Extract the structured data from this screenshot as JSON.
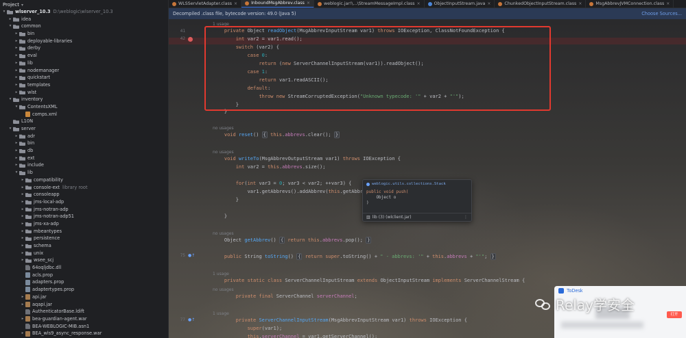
{
  "project": {
    "title": "Project",
    "root_name": "wlserver_10.3",
    "root_path": "D:\\weblogic\\wlserver_10.3",
    "items": [
      {
        "label": "idea",
        "depth": 1,
        "kind": "folder",
        "arrow": "right"
      },
      {
        "label": "common",
        "depth": 1,
        "kind": "folder",
        "arrow": "down"
      },
      {
        "label": "bin",
        "depth": 2,
        "kind": "folder",
        "arrow": "right"
      },
      {
        "label": "deployable-libraries",
        "depth": 2,
        "kind": "folder",
        "arrow": "right"
      },
      {
        "label": "derby",
        "depth": 2,
        "kind": "folder",
        "arrow": "right"
      },
      {
        "label": "eval",
        "depth": 2,
        "kind": "folder",
        "arrow": "right"
      },
      {
        "label": "lib",
        "depth": 2,
        "kind": "folder",
        "arrow": "right"
      },
      {
        "label": "nodemanager",
        "depth": 2,
        "kind": "folder",
        "arrow": "right"
      },
      {
        "label": "quickstart",
        "depth": 2,
        "kind": "folder",
        "arrow": "right"
      },
      {
        "label": "templates",
        "depth": 2,
        "kind": "folder",
        "arrow": "right"
      },
      {
        "label": "wlst",
        "depth": 2,
        "kind": "folder",
        "arrow": "right"
      },
      {
        "label": "inventory",
        "depth": 1,
        "kind": "folder",
        "arrow": "down"
      },
      {
        "label": "ContentsXML",
        "depth": 2,
        "kind": "folder",
        "arrow": "down"
      },
      {
        "label": "comps.xml",
        "depth": 3,
        "kind": "xml",
        "arrow": ""
      },
      {
        "label": "L10N",
        "depth": 1,
        "kind": "folder",
        "arrow": ""
      },
      {
        "label": "server",
        "depth": 1,
        "kind": "folder",
        "arrow": "down"
      },
      {
        "label": "adr",
        "depth": 2,
        "kind": "folder",
        "arrow": "right"
      },
      {
        "label": "bin",
        "depth": 2,
        "kind": "folder",
        "arrow": "right"
      },
      {
        "label": "db",
        "depth": 2,
        "kind": "folder",
        "arrow": "right"
      },
      {
        "label": "ext",
        "depth": 2,
        "kind": "folder",
        "arrow": "right"
      },
      {
        "label": "include",
        "depth": 2,
        "kind": "folder",
        "arrow": "right"
      },
      {
        "label": "lib",
        "depth": 2,
        "kind": "folder",
        "arrow": "down"
      },
      {
        "label": "compatibility",
        "depth": 3,
        "kind": "folder",
        "arrow": "right"
      },
      {
        "label": "console-ext",
        "depth": 3,
        "kind": "folder",
        "arrow": "right",
        "hint": "library root"
      },
      {
        "label": "consoleapp",
        "depth": 3,
        "kind": "folder",
        "arrow": "right"
      },
      {
        "label": "jms-local-adp",
        "depth": 3,
        "kind": "folder",
        "arrow": "right"
      },
      {
        "label": "jms-notran-adp",
        "depth": 3,
        "kind": "folder",
        "arrow": "right"
      },
      {
        "label": "jms-notran-adp51",
        "depth": 3,
        "kind": "folder",
        "arrow": "right"
      },
      {
        "label": "jms-xa-adp",
        "depth": 3,
        "kind": "folder",
        "arrow": "right"
      },
      {
        "label": "mbeantypes",
        "depth": 3,
        "kind": "folder",
        "arrow": "right"
      },
      {
        "label": "persistence",
        "depth": 3,
        "kind": "folder",
        "arrow": "right"
      },
      {
        "label": "schema",
        "depth": 3,
        "kind": "folder",
        "arrow": "right"
      },
      {
        "label": "unix",
        "depth": 3,
        "kind": "folder",
        "arrow": "right"
      },
      {
        "label": "wsee_scj",
        "depth": 3,
        "kind": "folder",
        "arrow": "right"
      },
      {
        "label": "64oqljdbc.dll",
        "depth": 3,
        "kind": "file",
        "arrow": ""
      },
      {
        "label": "acls.prop",
        "depth": 3,
        "kind": "prop",
        "arrow": ""
      },
      {
        "label": "adapters.prop",
        "depth": 3,
        "kind": "prop",
        "arrow": ""
      },
      {
        "label": "adaptertypes.prop",
        "depth": 3,
        "kind": "prop",
        "arrow": ""
      },
      {
        "label": "api.jar",
        "depth": 3,
        "kind": "jar",
        "arrow": "right"
      },
      {
        "label": "aqapi.jar",
        "depth": 3,
        "kind": "jar",
        "arrow": "right"
      },
      {
        "label": "AuthenticatorBase.ldift",
        "depth": 3,
        "kind": "file",
        "arrow": ""
      },
      {
        "label": "bea-guardian-agent.war",
        "depth": 3,
        "kind": "jar",
        "arrow": "right"
      },
      {
        "label": "BEA-WEBLOGIC-MIB.asn1",
        "depth": 3,
        "kind": "file",
        "arrow": ""
      },
      {
        "label": "BEA_wls9_async_response.war",
        "depth": 3,
        "kind": "jar",
        "arrow": "right"
      }
    ]
  },
  "tabs": [
    {
      "label": "WLSServletAdapter.class",
      "icon": "class",
      "active": false
    },
    {
      "label": "InboundMsgAbbrev.class",
      "icon": "class",
      "active": true
    },
    {
      "label": "weblogic.jar!\\...\\StreamMessageImpl.class",
      "icon": "class",
      "active": false
    },
    {
      "label": "ObjectInputStream.java",
      "icon": "java",
      "active": false
    },
    {
      "label": "ChunkedObjectInputStream.class",
      "icon": "class",
      "active": false
    },
    {
      "label": "MsgAbbrevJVMConnection.class",
      "icon": "class",
      "active": false
    }
  ],
  "banner": {
    "text": "Decompiled .class file, bytecode version: 49.0 (Java 5)",
    "action": "Choose Sources..."
  },
  "editor": {
    "line_numbers": [
      "41",
      "42",
      "",
      "",
      "",
      "",
      "",
      "",
      "",
      "",
      "",
      "",
      "",
      "",
      "",
      "",
      "",
      "",
      "",
      "",
      "",
      "",
      "",
      "",
      "",
      "",
      "",
      "",
      "",
      "",
      "",
      "",
      "",
      "",
      "",
      "",
      "75",
      "",
      "",
      "",
      "",
      "",
      "",
      "",
      "",
      "",
      "77"
    ],
    "usages_hints": {
      "one_usage": "1 usage",
      "no_usages": "no usages",
      "one_usage_b": "1 usage"
    }
  },
  "popup": {
    "header": "weblogic.utils.collections.Stack",
    "line1": "public void push(",
    "line2": "    Object o",
    "line3": ")",
    "footer": "lib (3) (wlclient.jar)"
  },
  "todesk": {
    "title": "ToDesk",
    "button": "打开"
  },
  "watermark": {
    "text": "Relay学安全"
  }
}
